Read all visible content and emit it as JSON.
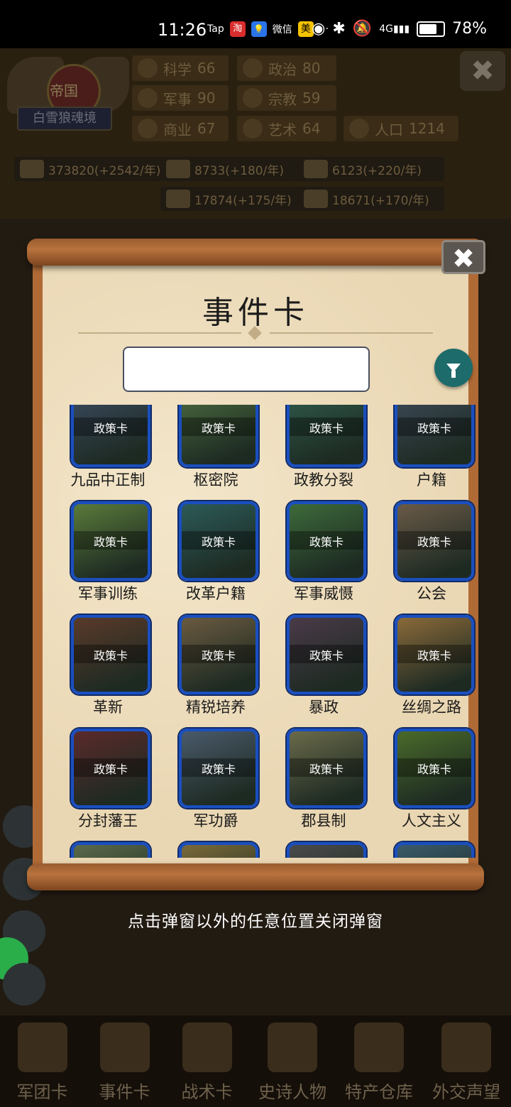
{
  "status": {
    "time": "11:26",
    "apps": [
      "Tap",
      "淘",
      "💡",
      "微信",
      "美",
      "···"
    ],
    "battery": "78%"
  },
  "hud": {
    "empire_title": "帝国",
    "empire_name": "白雪狼魂境",
    "stats": [
      {
        "label": "科学",
        "value": "66",
        "icon": "planet-icon"
      },
      {
        "label": "政治",
        "value": "80",
        "icon": "capitol-icon"
      },
      {
        "label": "军事",
        "value": "90",
        "icon": "swords-icon"
      },
      {
        "label": "宗教",
        "value": "59",
        "icon": "cross-icon"
      },
      {
        "label": "商业",
        "value": "67",
        "icon": "scale-icon"
      },
      {
        "label": "艺术",
        "value": "64",
        "icon": "leaf-icon"
      },
      {
        "label": "人口",
        "value": "1214",
        "icon": "person-icon"
      }
    ],
    "resources": [
      {
        "text": "373820(+2542/年)",
        "icon": "gold-icon"
      },
      {
        "text": "8733(+180/年)",
        "icon": "wood-icon"
      },
      {
        "text": "6123(+220/年)",
        "icon": "iron-icon"
      },
      {
        "text": "17874(+175/年)",
        "icon": "stone-icon"
      },
      {
        "text": "18671(+170/年)",
        "icon": "meat-icon"
      }
    ]
  },
  "modal": {
    "title": "事件卡",
    "search_value": "",
    "close_glyph": "✖",
    "card_tag": "政策卡",
    "cards": [
      {
        "name": "九品中正制",
        "bg": "#3a4a5e"
      },
      {
        "name": "枢密院",
        "bg": "#4a6a3e"
      },
      {
        "name": "政教分裂",
        "bg": "#2f5a4a"
      },
      {
        "name": "户籍",
        "bg": "#3d4a58"
      },
      {
        "name": "军事训练",
        "bg": "#5a7a3a"
      },
      {
        "name": "改革户籍",
        "bg": "#2c5a58"
      },
      {
        "name": "军事威慑",
        "bg": "#3d6a3a"
      },
      {
        "name": "公会",
        "bg": "#6a5a48"
      },
      {
        "name": "革新",
        "bg": "#5a3a2a"
      },
      {
        "name": "精锐培养",
        "bg": "#6a5a40"
      },
      {
        "name": "暴政",
        "bg": "#4a3a48"
      },
      {
        "name": "丝绸之路",
        "bg": "#8a6a3a"
      },
      {
        "name": "分封藩王",
        "bg": "#5a2a2a"
      },
      {
        "name": "军功爵",
        "bg": "#4a5a6a"
      },
      {
        "name": "郡县制",
        "bg": "#6a6a4a"
      },
      {
        "name": "人文主义",
        "bg": "#4a6a2a"
      },
      {
        "name": "",
        "bg": "#5a6a4a"
      },
      {
        "name": "",
        "bg": "#7a6a3a"
      },
      {
        "name": "",
        "bg": "#4a4a4a"
      },
      {
        "name": "",
        "bg": "#3a5a6a"
      }
    ]
  },
  "hint": "点击弹窗以外的任意位置关闭弹窗",
  "nav": [
    "军团卡",
    "事件卡",
    "战术卡",
    "史诗人物",
    "特产仓库",
    "外交声望"
  ]
}
